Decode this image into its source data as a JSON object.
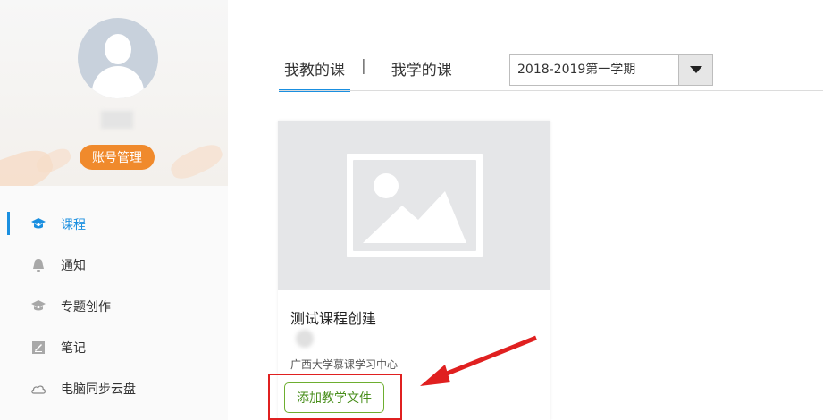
{
  "sidebar": {
    "account_button": "账号管理",
    "nav": [
      {
        "label": "课程",
        "icon": "course-icon",
        "active": true
      },
      {
        "label": "通知",
        "icon": "bell-icon",
        "active": false
      },
      {
        "label": "专题创作",
        "icon": "topic-icon",
        "active": false
      },
      {
        "label": "笔记",
        "icon": "note-icon",
        "active": false
      },
      {
        "label": "电脑同步云盘",
        "icon": "cloud-icon",
        "active": false
      }
    ]
  },
  "main": {
    "tabs": [
      {
        "label": "我教的课",
        "active": true
      },
      {
        "label": "我学的课",
        "active": false
      }
    ],
    "separator": "|",
    "semester_select": {
      "value": "2018-2019第一学期"
    },
    "course_card": {
      "title": "测试课程创建",
      "organization": "广西大学慕课学习中心",
      "add_button": "添加教学文件"
    }
  },
  "colors": {
    "accent": "#1a8fe0",
    "account_button": "#f08a2c",
    "add_button_border": "#6dae2f",
    "annotation_red": "#e02020"
  }
}
